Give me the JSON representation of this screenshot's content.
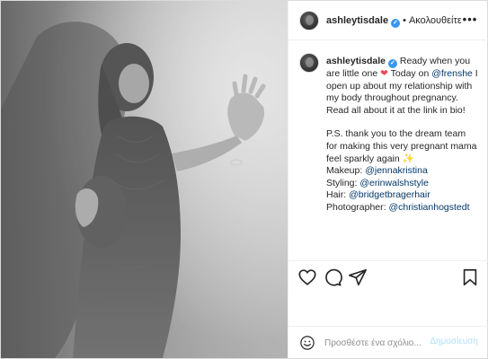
{
  "post": {
    "username": "ashleytisdale",
    "verified_mark": "✓",
    "dot": "•",
    "follow_label": "Ακολουθείτε",
    "more_label": "•••"
  },
  "caption": {
    "username": "ashleytisdale",
    "text_1": " Ready when you are little one ",
    "text_2": " Today on ",
    "mention_frenshe": "@frenshe",
    "text_3": " I open up about my relationship with my body throughout pregnancy. Read all about it at the link in bio!",
    "ps_text": "P.S. thank you to the dream team for making this very pregnant mama feel sparkly again ",
    "makeup_label": "Makeup: ",
    "makeup_mention": "@jennakristina",
    "styling_label": "Styling: ",
    "styling_mention": "@erinwalshstyle",
    "hair_label": "Hair: ",
    "hair_mention": "@bridgetbragerhair",
    "photographer_label": "Photographer: ",
    "photographer_mention": "@christianhogstedt",
    "heart_glyph": "❤",
    "sparkle_glyph": "✨"
  },
  "actions": {
    "like": "heart-icon",
    "comment": "comment-icon",
    "share": "paper-plane-icon",
    "save": "bookmark-icon"
  },
  "comment_bar": {
    "placeholder": "Προσθέστε ένα σχόλιο...",
    "post_label": "Δημοσίευση"
  },
  "colors": {
    "link": "#00376b",
    "post_button_disabled": "#b2dffc",
    "heart": "#ed4956",
    "verified": "#3897f0"
  }
}
